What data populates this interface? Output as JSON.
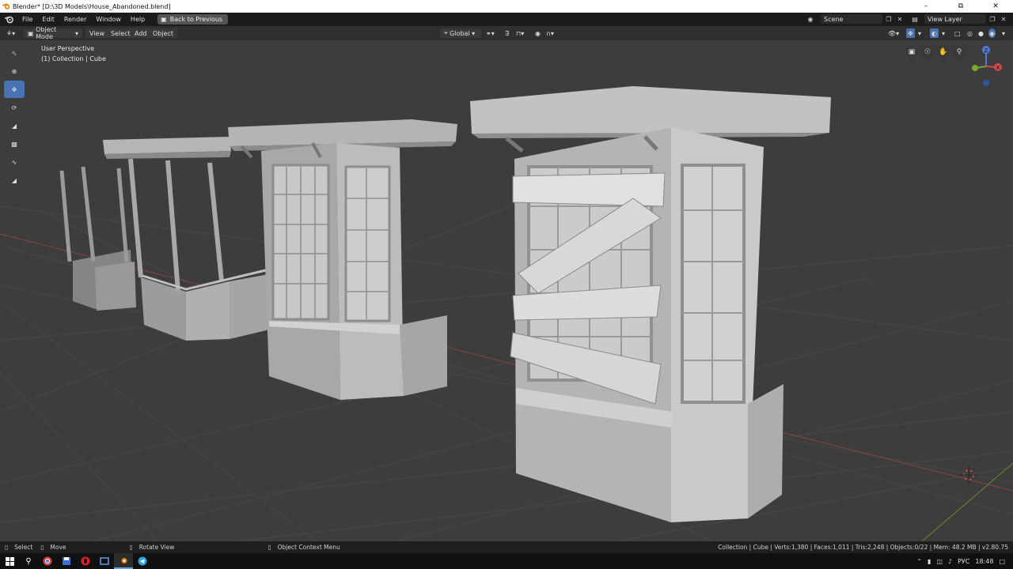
{
  "title": "Blender* [D:\\3D Models\\House_Abandoned.blend]",
  "menu": [
    "File",
    "Edit",
    "Render",
    "Window",
    "Help"
  ],
  "back_label": "Back to Previous",
  "scene": "Scene",
  "view_layer": "View Layer",
  "header": {
    "mode": "Object Mode",
    "view": "View",
    "select": "Select",
    "add": "Add",
    "object": "Object",
    "orientation": "Global"
  },
  "viewport": {
    "perspective": "User Perspective",
    "collection": "(1) Collection | Cube"
  },
  "gizmo": {
    "z": "Z",
    "y": "Y",
    "x": "X"
  },
  "status": {
    "select": "Select",
    "move": "Move",
    "rotate": "Rotate View",
    "context": "Object Context Menu",
    "info": "Collection | Cube | Verts:1,380 | Faces:1,011 | Tris:2,248 | Objects:0/22 | Mem: 48.2 MB | v2.80.75"
  },
  "taskbar": {
    "lang": "РУС",
    "time": "18:48"
  },
  "colors": {
    "accent": "#4772b3",
    "xaxis": "#a64444",
    "yaxis": "#7b9f2c",
    "background": "#3d3d3d"
  }
}
